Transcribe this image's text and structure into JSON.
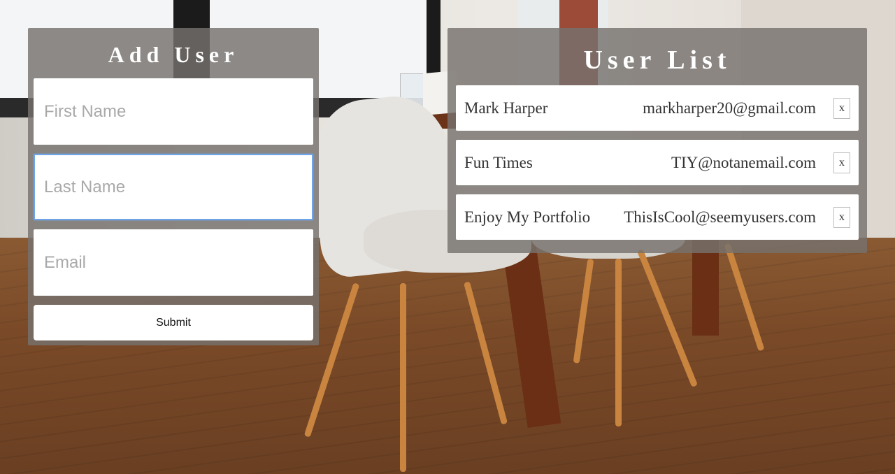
{
  "add_user": {
    "title": "Add User",
    "first_name_placeholder": "First Name",
    "last_name_placeholder": "Last Name",
    "email_placeholder": "Email",
    "submit_label": "Submit"
  },
  "user_list": {
    "title": "User List",
    "users": [
      {
        "name": "Mark Harper",
        "email": "markharper20@gmail.com",
        "delete_label": "x"
      },
      {
        "name": "Fun Times",
        "email": "TIY@notanemail.com",
        "delete_label": "x"
      },
      {
        "name": "Enjoy My Portfolio",
        "email": "ThisIsCool@seemyusers.com",
        "delete_label": "x"
      }
    ]
  },
  "colors": {
    "panel_overlay": "#76726e",
    "focus_outline": "#6fa4e6",
    "title_text": "#ffffff"
  }
}
